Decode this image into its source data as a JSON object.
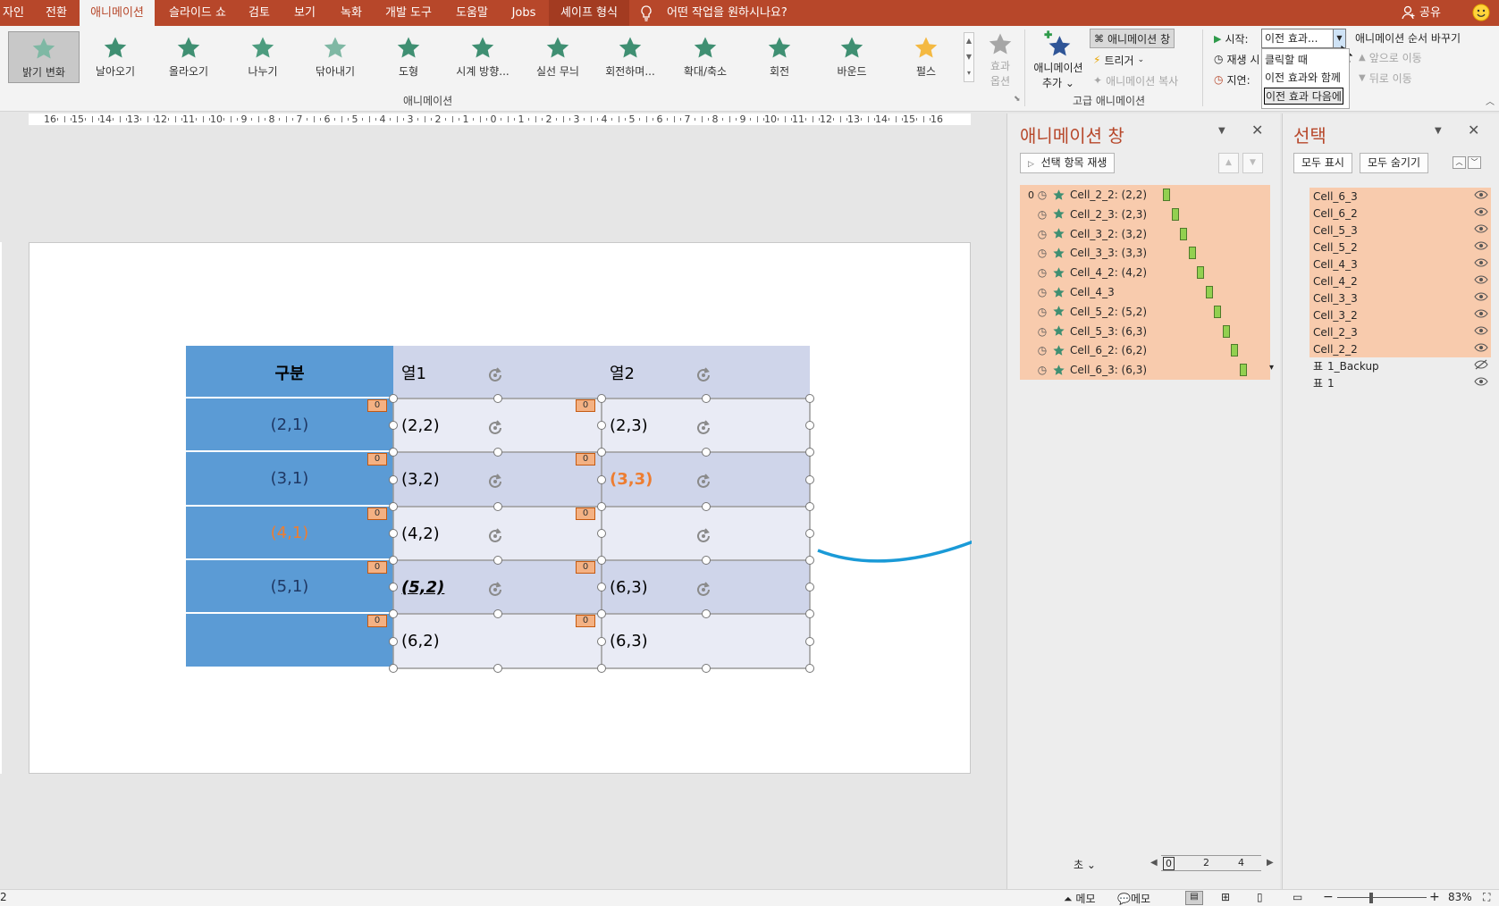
{
  "ribbon": {
    "tabs": [
      {
        "label": "자인"
      },
      {
        "label": "전환"
      },
      {
        "label": "애니메이션"
      },
      {
        "label": "슬라이드 쇼"
      },
      {
        "label": "검토"
      },
      {
        "label": "보기"
      },
      {
        "label": "녹화"
      },
      {
        "label": "개발 도구"
      },
      {
        "label": "도움말"
      },
      {
        "label": "Jobs"
      },
      {
        "label": "셰이프 형식"
      }
    ],
    "tell_me": "어떤 작업을 원하시나요?",
    "share": "공유",
    "gallery": [
      {
        "label": "밝기 변화"
      },
      {
        "label": "날아오기"
      },
      {
        "label": "올라오기"
      },
      {
        "label": "나누기"
      },
      {
        "label": "닦아내기"
      },
      {
        "label": "도형"
      },
      {
        "label": "시계 방향..."
      },
      {
        "label": "실선 무늬"
      },
      {
        "label": "회전하며..."
      },
      {
        "label": "확대/축소"
      },
      {
        "label": "회전"
      },
      {
        "label": "바운드"
      },
      {
        "label": "펄스"
      }
    ],
    "effect_options": {
      "line1": "효과",
      "line2": "옵션"
    },
    "group_animation": "애니메이션",
    "add_animation": {
      "line1": "애니메이션",
      "line2": "추가"
    },
    "animation_pane_btn": "애니메이션 창",
    "trigger": "트리거",
    "animation_painter": "애니메이션 복사",
    "group_advanced": "고급 애니메이션",
    "start_label": "시작:",
    "start_value": "이전 효과...",
    "play_label": "재생 시",
    "delay_label": "지연:",
    "dropdown_options": [
      {
        "label": "클릭할 때"
      },
      {
        "label": "이전 효과와 함께"
      },
      {
        "label": "이전 효과 다음에"
      }
    ],
    "reorder_title": "애니메이션 순서 바꾸기",
    "move_earlier": "앞으로 이동",
    "move_later": "뒤로 이동"
  },
  "ruler": [
    "16",
    "15",
    "14",
    "13",
    "12",
    "11",
    "10",
    "9",
    "8",
    "7",
    "6",
    "5",
    "4",
    "3",
    "2",
    "1",
    "0",
    "1",
    "2",
    "3",
    "4",
    "5",
    "6",
    "7",
    "8",
    "9",
    "10",
    "11",
    "12",
    "13",
    "14",
    "15",
    "16"
  ],
  "table": {
    "header": {
      "left": "구분",
      "col1": "열1",
      "col2": "열2"
    },
    "rows": [
      {
        "left": "(2,1)",
        "c1": "(2,2)",
        "c2": "(2,3)"
      },
      {
        "left": "(3,1)",
        "c1": "(3,2)",
        "c2": "(3,3)"
      },
      {
        "left": "(4,1)",
        "c1": "(4,2)",
        "c2": ""
      },
      {
        "left": "(5,1)",
        "c1": "(5,2)",
        "c2": "(6,3)"
      },
      {
        "left": "",
        "c1": "(6,2)",
        "c2": "(6,3)"
      }
    ],
    "tag_value": "0"
  },
  "animation_pane": {
    "title": "애니메이션 창",
    "play_button": "선택 항목 재생",
    "first_index": "0",
    "items": [
      {
        "label": "Cell_2_2: (2,2)"
      },
      {
        "label": "Cell_2_3: (2,3)"
      },
      {
        "label": "Cell_3_2: (3,2)"
      },
      {
        "label": "Cell_3_3: (3,3)"
      },
      {
        "label": "Cell_4_2: (4,2)"
      },
      {
        "label": "Cell_4_3"
      },
      {
        "label": "Cell_5_2: (5,2)"
      },
      {
        "label": "Cell_5_3: (6,3)"
      },
      {
        "label": "Cell_6_2: (6,2)"
      },
      {
        "label": "Cell_6_3: (6,3)"
      }
    ],
    "seconds_label": "초",
    "timeline": [
      "0",
      "2",
      "4"
    ]
  },
  "selection_pane": {
    "title": "선택",
    "show_all": "모두 표시",
    "hide_all": "모두 숨기기",
    "items": [
      {
        "label": "Cell_6_3"
      },
      {
        "label": "Cell_6_2"
      },
      {
        "label": "Cell_5_3"
      },
      {
        "label": "Cell_5_2"
      },
      {
        "label": "Cell_4_3"
      },
      {
        "label": "Cell_4_2"
      },
      {
        "label": "Cell_3_3"
      },
      {
        "label": "Cell_3_2"
      },
      {
        "label": "Cell_2_3"
      },
      {
        "label": "Cell_2_2"
      },
      {
        "label": "1_Backup"
      },
      {
        "label": "1"
      }
    ],
    "group_prefix": "표"
  },
  "status": {
    "slide_num": "2",
    "notes1": "메모",
    "notes2": "메모",
    "zoom": "83%"
  },
  "colors": {
    "accent": "#b7472a",
    "table_header_blue": "#5b9bd5",
    "highlight_orange": "#c55a11",
    "pane_selection": "#f8cbad",
    "arrow": "#1a9ad7"
  }
}
